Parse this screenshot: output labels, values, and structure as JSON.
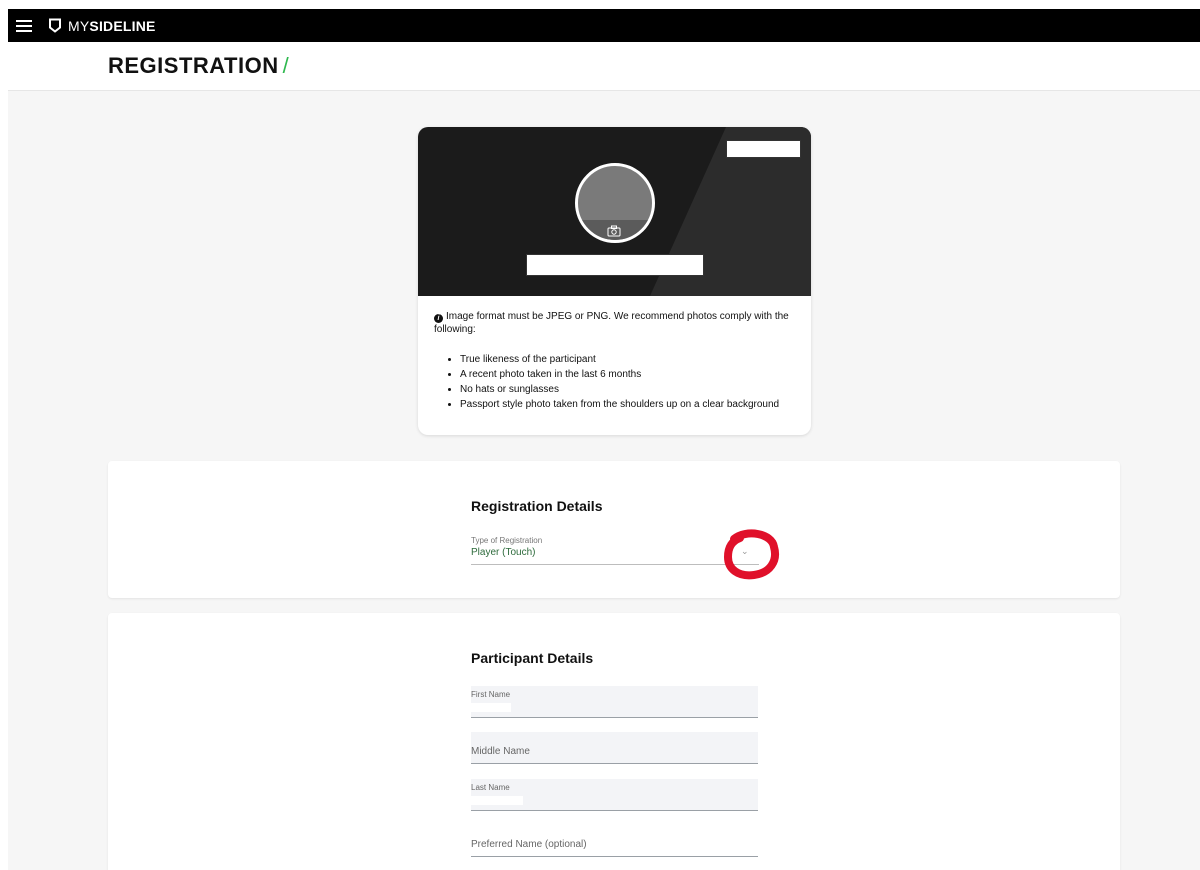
{
  "app": {
    "brand_prefix": "MY",
    "brand_name": "SIDELINE"
  },
  "page": {
    "title": "REGISTRATION",
    "title_separator": "/",
    "accent_color": "#2fb84f"
  },
  "photo_card": {
    "info_text": "Image format must be JPEG or PNG. We recommend photos comply with the following:",
    "guidelines": [
      "True likeness of the participant",
      "A recent photo taken in the last 6 months",
      "No hats or sunglasses",
      "Passport style photo taken from the shoulders up on a clear background"
    ]
  },
  "registration_details": {
    "title": "Registration Details",
    "type_label": "Type of Registration",
    "type_value": "Player (Touch)"
  },
  "participant_details": {
    "title": "Participant Details",
    "first_name_label": "First Name",
    "middle_name_placeholder": "Middle Name",
    "last_name_label": "Last Name",
    "preferred_name_placeholder": "Preferred Name (optional)"
  },
  "icons": {
    "menu": "hamburger-icon",
    "logo": "shield-icon",
    "camera": "camera-icon",
    "info": "info-icon",
    "dropdown": "chevron-down-icon"
  }
}
